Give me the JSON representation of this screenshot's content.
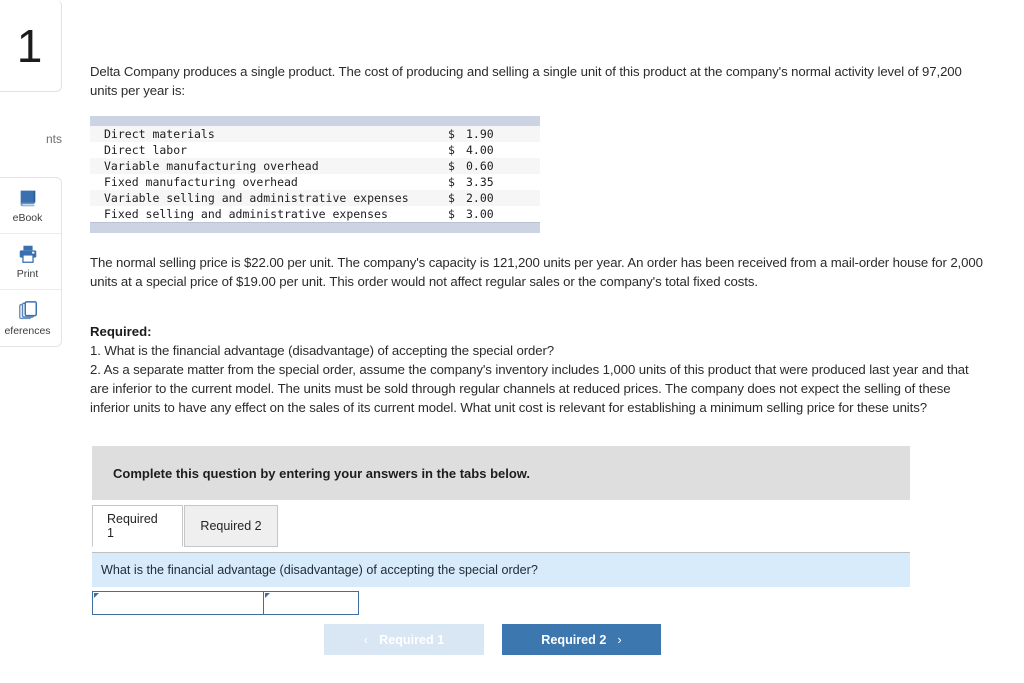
{
  "sidebar": {
    "question_number": "1",
    "points_label": "nts",
    "tools": [
      {
        "icon": "book-icon",
        "label": "eBook"
      },
      {
        "icon": "printer-icon",
        "label": "Print"
      },
      {
        "icon": "copy-pages-icon",
        "label": "eferences"
      }
    ]
  },
  "problem": {
    "intro": "Delta Company produces a single product. The cost of producing and selling a single unit of this product at the company's normal activity level of 97,200 units per year is:",
    "price_paragraph": "The normal selling price is $22.00 per unit. The company's capacity is 121,200 units per year. An order has been received from a mail-order house for 2,000 units at a special price of $19.00 per unit. This order would not affect regular sales or the company's total fixed costs."
  },
  "cost_table": {
    "rows": [
      {
        "label": "Direct materials",
        "symbol": "$",
        "amount": "1.90"
      },
      {
        "label": "Direct labor",
        "symbol": "$",
        "amount": "4.00"
      },
      {
        "label": "Variable manufacturing overhead",
        "symbol": "$",
        "amount": "0.60"
      },
      {
        "label": "Fixed manufacturing overhead",
        "symbol": "$",
        "amount": "3.35"
      },
      {
        "label": "Variable selling and administrative expenses",
        "symbol": "$",
        "amount": "2.00"
      },
      {
        "label": "Fixed selling and administrative expenses",
        "symbol": "$",
        "amount": "3.00"
      }
    ]
  },
  "required": {
    "heading": "Required:",
    "items": [
      "1. What is the financial advantage (disadvantage) of accepting the special order?",
      "2. As a separate matter from the special order, assume the company's inventory includes 1,000 units of this product that were produced last year and that are inferior to the current model. The units must be sold through regular channels at reduced prices. The company does not expect the selling of these inferior units to have any effect on the sales of its current model. What unit cost is relevant for establishing a minimum selling price for these units?"
    ]
  },
  "answer_area": {
    "instruction": "Complete this question by entering your answers in the tabs below.",
    "tabs": [
      {
        "label": "Required 1",
        "active": true
      },
      {
        "label": "Required 2",
        "active": false
      }
    ],
    "question_banner": "What is the financial advantage (disadvantage) of accepting the special order?",
    "inputs": [
      {
        "name": "answer-label-input",
        "value": "",
        "placeholder": ""
      },
      {
        "name": "answer-amount-input",
        "value": "",
        "placeholder": ""
      }
    ],
    "nav": {
      "prev_label": "Required 1",
      "prev_chevron": "‹",
      "next_label": "Required 2",
      "next_chevron": "›"
    }
  },
  "colors": {
    "accent_blue": "#3c77b0",
    "disabled_blue": "#d9e6f3",
    "banner_blue": "#d7ebfa",
    "instruction_gray": "#dedede",
    "table_band": "#ccd3e2",
    "icon_blue": "#3a6fb0"
  }
}
